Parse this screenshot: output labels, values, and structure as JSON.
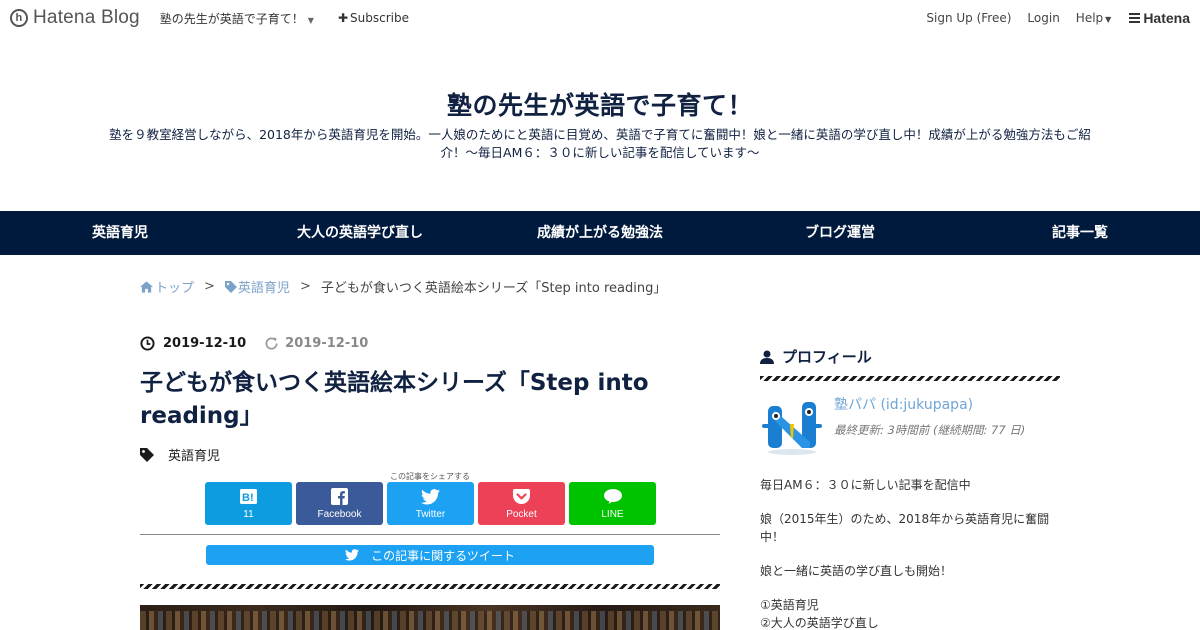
{
  "topbar": {
    "logo_mark": "h",
    "logo_text": "Hatena Blog",
    "blog_select": "塾の先生が英語で子育て！",
    "subscribe": "Subscribe",
    "signup": "Sign Up (Free)",
    "login": "Login",
    "help": "Help",
    "hatena": "Hatena"
  },
  "header": {
    "title": "塾の先生が英語で子育て！",
    "description": "塾を９教室経営しながら、2018年から英語育児を開始。一人娘のためにと英語に目覚め、英語で子育てに奮闘中！娘と一緒に英語の学び直し中！成績が上がる勉強方法もご紹介！～毎日AM６：３０に新しい記事を配信しています～"
  },
  "nav": {
    "items": [
      {
        "label": "英語育児"
      },
      {
        "label": "大人の英語学び直し"
      },
      {
        "label": "成績が上がる勉強法"
      },
      {
        "label": "ブログ運営"
      },
      {
        "label": "記事一覧"
      }
    ]
  },
  "breadcrumb": {
    "home": "トップ",
    "category": "英語育児",
    "current": "子どもが食いつく英語絵本シリーズ「Step into reading」",
    "separator": ">"
  },
  "article": {
    "date_published": "2019-12-10",
    "date_updated": "2019-12-10",
    "title": "子どもが食いつく英語絵本シリーズ「Step into reading」",
    "category": "英語育児",
    "share_caption": "この記事をシェアする",
    "share": {
      "hatena_count": "11",
      "facebook": "Facebook",
      "twitter": "Twitter",
      "pocket": "Pocket",
      "line": "LINE"
    },
    "tweet_bar": "この記事に関するツイート"
  },
  "sidebar": {
    "profile_heading": "プロフィール",
    "profile_name": "塾パパ (id:jukupapa)",
    "profile_meta": "最終更新: 3時間前 (継続期間: 77 日)",
    "para1": "毎日AM６：３０に新しい記事を配信中",
    "para2": "娘（2015年生）のため、2018年から英語育児に奮闘中！",
    "para3": "娘と一緒に英語の学び直しも開始！",
    "list": [
      "①英語育児",
      "②大人の英語学び直し"
    ]
  },
  "colors": {
    "nav_bg": "#001a3d",
    "title": "#102141",
    "link": "#7ba3c9",
    "hatena": "#0e9ce0",
    "facebook": "#3b5a9a",
    "twitter": "#1da1f2",
    "pocket": "#ec4157",
    "line": "#00c300"
  }
}
